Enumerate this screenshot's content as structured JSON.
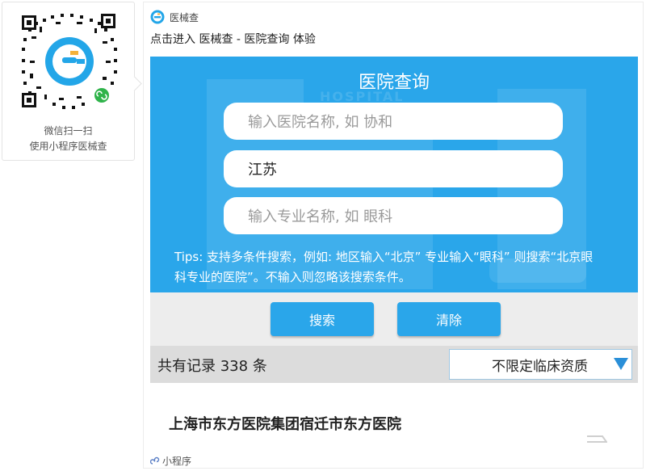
{
  "qr": {
    "caption_line1": "微信扫一扫",
    "caption_line2": "使用小程序医械查"
  },
  "card": {
    "app_name": "医械查",
    "title": "点击进入 医械查 - 医院查询 体验",
    "footer_label": "小程序"
  },
  "hero": {
    "title": "医院查询",
    "hospital_name_field": {
      "placeholder": "输入医院名称, 如 协和",
      "value": ""
    },
    "region_field": {
      "placeholder": "",
      "value": "江苏"
    },
    "specialty_field": {
      "placeholder": "输入专业名称, 如 眼科",
      "value": ""
    },
    "tips": "Tips: 支持多条件搜索，例如: 地区输入“北京” 专业输入“眼科” 则搜索“北京眼科专业的医院”。不输入则忽略该搜索条件。"
  },
  "buttons": {
    "search_label": "搜索",
    "clear_label": "清除"
  },
  "results": {
    "count_text": "共有记录 338 条",
    "filter_selected": "不限定临床资质",
    "first_item": "上海市东方医院集团宿迁市东方医院"
  },
  "colors": {
    "accent": "#2aa6ea",
    "filter_arrow": "#2a8fd8"
  }
}
